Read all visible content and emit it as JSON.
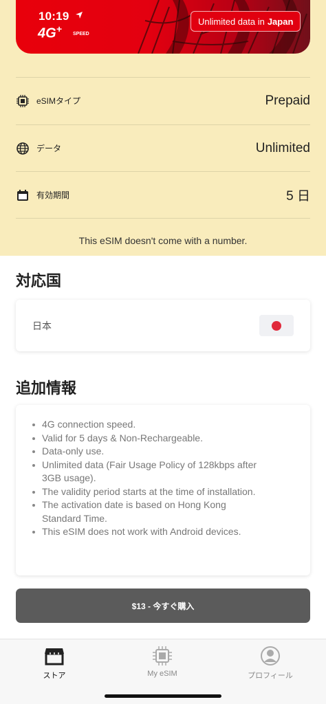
{
  "banner": {
    "time": "10:19",
    "logo_main": "4G",
    "logo_plus": "+",
    "logo_speed": "SPEED",
    "tag_text": "Unlimited data in",
    "tag_country": "Japan",
    "bg_color": "#e8000b"
  },
  "details": [
    {
      "icon": "chip-icon",
      "label": "eSIMタイプ",
      "value": "Prepaid"
    },
    {
      "icon": "globe-icon",
      "label": "データ",
      "value": "Unlimited"
    },
    {
      "icon": "calendar-icon",
      "label": "有効期間",
      "value": "5 日"
    }
  ],
  "no_number_note": "This eSIM doesn't come with a number.",
  "countries_section": {
    "title": "対応国",
    "country": "日本",
    "flag": "japan-flag-icon"
  },
  "additional_info": {
    "title": "追加情報",
    "items": [
      "4G connection speed.",
      "Valid for 5 days & Non-Rechargeable.",
      "Data-only use.",
      "Unlimited data (Fair Usage Policy of 128kbps after 3GB usage).",
      "The validity period starts at the time of installation.",
      "The activation date is based on Hong Kong Standard Time.",
      "This eSIM does not work with Android devices."
    ]
  },
  "buy_button": {
    "label": "$13 - 今すぐ購入",
    "color": "#5b5b5b"
  },
  "tabs": [
    {
      "label": "ストア",
      "icon": "store-icon",
      "active": true
    },
    {
      "label": "My eSIM",
      "icon": "sim-chip-icon",
      "active": false
    },
    {
      "label": "プロフィール",
      "icon": "profile-icon",
      "active": false
    }
  ],
  "colors": {
    "info_bg": "#f9ecbc",
    "accent_red": "#e8000b"
  }
}
